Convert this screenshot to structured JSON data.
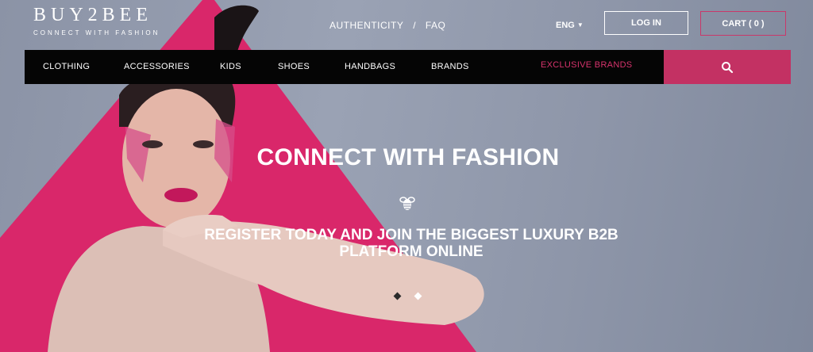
{
  "brand": {
    "logo": "BUY2BEE",
    "tagline": "CONNECT WITH FASHION"
  },
  "top_links": {
    "authenticity": "AUTHENTICITY",
    "separator": "/",
    "faq": "FAQ"
  },
  "language": {
    "selected": "ENG",
    "icon": "caret-down-icon"
  },
  "auth": {
    "login_label": "LOG IN",
    "cart_label": "CART ( 0 )"
  },
  "nav": {
    "items": [
      "CLOTHING",
      "ACCESSORIES",
      "KIDS",
      "SHOES",
      "HANDBAGS",
      "BRANDS",
      "EXCLUSIVE BRANDS"
    ],
    "search_icon": "search-icon"
  },
  "hero": {
    "title": "CONNECT WITH FASHION",
    "icon": "bee-icon",
    "subtitle_line1": "REGISTER TODAY AND JOIN THE BIGGEST LUXURY B2B",
    "subtitle_line2": "PLATFORM ONLINE",
    "slides_total": 2,
    "slide_active": 2
  },
  "colors": {
    "accent": "#c33163",
    "exclusive": "#d6336c",
    "nav_bg": "#050505",
    "magenta": "#d9276a"
  }
}
